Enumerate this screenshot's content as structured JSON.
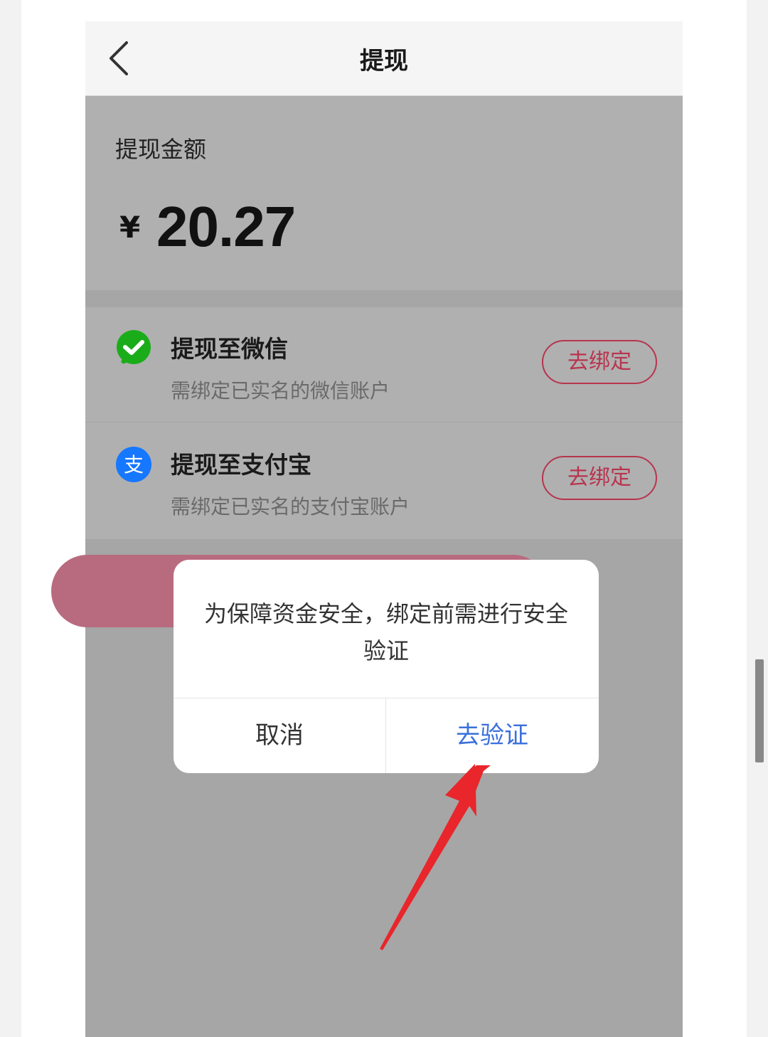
{
  "nav": {
    "title": "提现"
  },
  "amount": {
    "label": "提现金额",
    "currency": "¥",
    "value": "20.27"
  },
  "options": [
    {
      "title": "提现至微信",
      "subtitle": "需绑定已实名的微信账户",
      "button": "去绑定",
      "icon": "wechat-pay-icon",
      "icon_color": "#1aad19"
    },
    {
      "title": "提现至支付宝",
      "subtitle": "需绑定已实名的支付宝账户",
      "button": "去绑定",
      "icon": "alipay-icon",
      "icon_color": "#1677ff"
    }
  ],
  "dialog": {
    "message": "为保障资金安全，绑定前需进行安全验证",
    "cancel": "取消",
    "confirm": "去验证"
  },
  "colors": {
    "accent": "#b8344f",
    "link": "#3a6fdc",
    "arrow": "#e8262b"
  }
}
